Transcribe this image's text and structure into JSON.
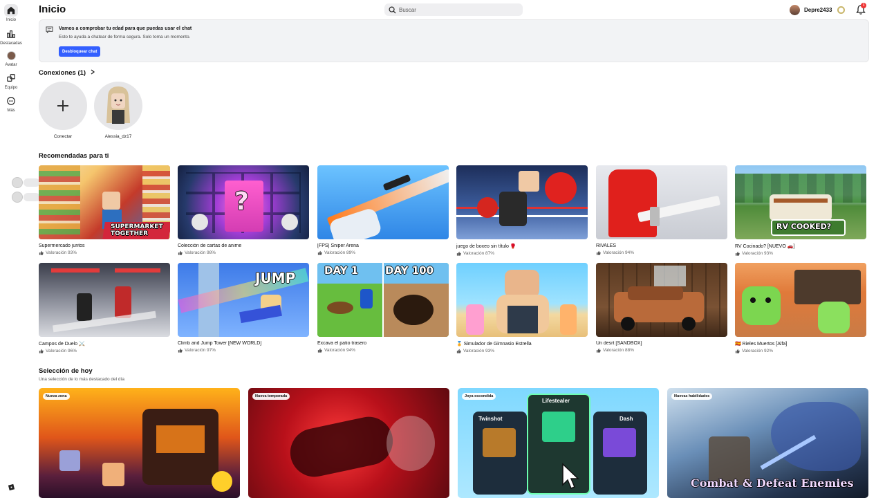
{
  "nav": {
    "items": [
      {
        "label": "Inicio",
        "icon": "home-icon"
      },
      {
        "label": "Destacadas",
        "icon": "charts-icon"
      },
      {
        "label": "Avatar",
        "icon": "avatar-icon"
      },
      {
        "label": "Equipo",
        "icon": "party-icon"
      },
      {
        "label": "Más",
        "icon": "more-icon"
      }
    ]
  },
  "header": {
    "title": "Inicio",
    "search_placeholder": "Buscar",
    "username": "Depre2433",
    "notifications": "3"
  },
  "banner": {
    "title": "Vamos a comprobar tu edad para que puedas usar el chat",
    "subtitle": "Esto te ayuda a chatear de forma segura. Solo toma un momento.",
    "button": "Desbloquear chat"
  },
  "connections": {
    "title": "Conexiones (1)",
    "items": [
      {
        "label": "Conectar"
      },
      {
        "label": "Alessia_dz17"
      }
    ]
  },
  "recommended": {
    "title": "Recomendadas para ti",
    "games": [
      {
        "title": "Supermercado juntos",
        "rating": "Valoración 93%",
        "overlay": "SUPERMARKET TOGETHER"
      },
      {
        "title": "Colección de cartas de anime",
        "rating": "Valoración 98%",
        "overlay": "?"
      },
      {
        "title": "[FPS] Sniper Arena",
        "rating": "Valoración 89%",
        "overlay": ""
      },
      {
        "title": "juego de boxeo sin título 🥊",
        "rating": "Valoración 87%",
        "overlay": ""
      },
      {
        "title": "RIVALES",
        "rating": "Valoración 94%",
        "overlay": ""
      },
      {
        "title": "RV Cocinado? [NUEVO 🚗]",
        "rating": "Valoración 93%",
        "overlay": "RV COOKED?"
      },
      {
        "title": "Campos de Duelo ⚔️",
        "rating": "Valoración 96%",
        "overlay": ""
      },
      {
        "title": "Climb and Jump Tower [NEW WORLD]",
        "rating": "Valoración 97%",
        "overlay": "JUMP"
      },
      {
        "title": "Excava el patio trasero",
        "rating": "Valoración 94%",
        "overlay": "DAY 1 · DAY 100"
      },
      {
        "title": "🏅 Simulador de Gimnasio Estrella",
        "rating": "Valoración 93%",
        "overlay": ""
      },
      {
        "title": "Un desrt [SANDBOX]",
        "rating": "Valoración 88%",
        "overlay": ""
      },
      {
        "title": "🇪🇸 Rieles Muertos [Alfa]",
        "rating": "Valoración 92%",
        "overlay": ""
      }
    ]
  },
  "today": {
    "title": "Selección de hoy",
    "subtitle": "Una selección de lo más destacado del día",
    "picks": [
      {
        "tag": "Nueva zona"
      },
      {
        "tag": "Nueva temporada"
      },
      {
        "tag": "Joya escondida"
      },
      {
        "tag": "Nuevas habilidades",
        "overlay": "Combat & Defeat Enemies"
      }
    ],
    "pick3_cards": [
      "Twinshot",
      "Lifestealer",
      "Dash"
    ]
  },
  "colors": {
    "accent": "#335fff",
    "notification": "#e33333"
  }
}
